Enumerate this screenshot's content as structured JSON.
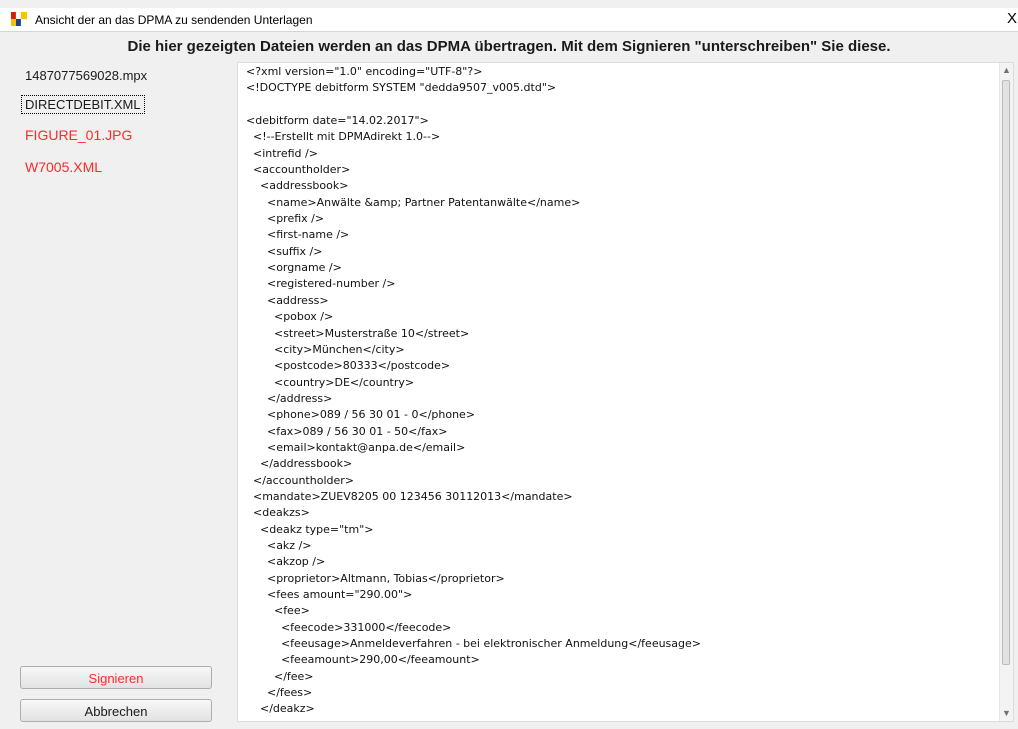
{
  "window": {
    "title": "Ansicht der an das DPMA zu sendenden Unterlagen",
    "close_label": "X",
    "icon": "dpma-app-icon"
  },
  "header": {
    "text": "Die hier gezeigten Dateien werden an das DPMA übertragen. Mit dem Signieren \"unterschreiben\" Sie diese."
  },
  "files": [
    {
      "label": "1487077569028.mpx",
      "color": "#1a1a1a",
      "selected": false
    },
    {
      "label": "DIRECTDEBIT.XML",
      "color": "#1a1a1a",
      "selected": true
    },
    {
      "label": "FIGURE_01.JPG",
      "color": "#ff2a2a",
      "selected": false
    },
    {
      "label": "W7005.XML",
      "color": "#ff2a2a",
      "selected": false
    }
  ],
  "buttons": {
    "sign": "Signieren",
    "cancel": "Abbrechen"
  },
  "xml_lines": [
    "<?xml version=\"1.0\" encoding=\"UTF-8\"?>",
    "<!DOCTYPE debitform SYSTEM \"dedda9507_v005.dtd\">",
    "",
    "<debitform date=\"14.02.2017\">",
    "  <!--Erstellt mit DPMAdirekt 1.0-->",
    "  <intrefid />",
    "  <accountholder>",
    "    <addressbook>",
    "      <name>Anwälte &amp; Partner Patentanwälte</name>",
    "      <prefix />",
    "      <first-name />",
    "      <suffix />",
    "      <orgname />",
    "      <registered-number />",
    "      <address>",
    "        <pobox />",
    "        <street>Musterstraße 10</street>",
    "        <city>München</city>",
    "        <postcode>80333</postcode>",
    "        <country>DE</country>",
    "      </address>",
    "      <phone>089 / 56 30 01 - 0</phone>",
    "      <fax>089 / 56 30 01 - 50</fax>",
    "      <email>kontakt@anpa.de</email>",
    "    </addressbook>",
    "  </accountholder>",
    "  <mandate>ZUEV8205 00 123456 30112013</mandate>",
    "  <deakzs>",
    "    <deakz type=\"tm\">",
    "      <akz />",
    "      <akzop />",
    "      <proprietor>Altmann, Tobias</proprietor>",
    "      <fees amount=\"290.00\">",
    "        <fee>",
    "          <feecode>331000</feecode>",
    "          <feeusage>Anmeldeverfahren - bei elektronischer Anmeldung</feeusage>",
    "          <feeamount>290,00</feeamount>",
    "        </fee>",
    "      </fees>",
    "    </deakz>"
  ],
  "scrollbar": {
    "up_icon": "scroll-up-arrow-icon",
    "down_icon": "scroll-down-arrow-icon"
  }
}
